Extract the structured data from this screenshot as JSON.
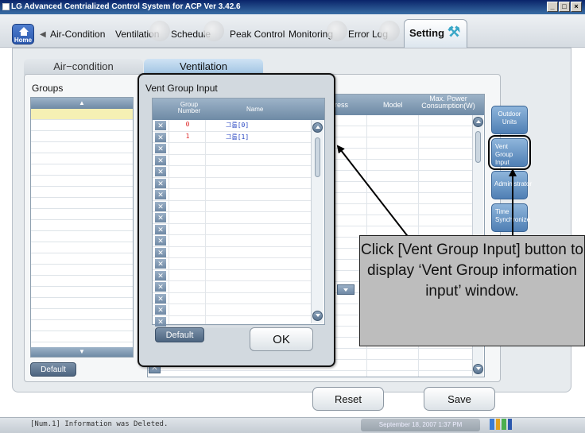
{
  "window": {
    "title": "LG Advanced Centrialized Control System for ACP Ver 3.42.6",
    "buttons": [
      "_",
      "□",
      "×"
    ]
  },
  "nav": {
    "home_label": "Home",
    "tabs": [
      "Air-Condition",
      "Ventilation",
      "Schedule",
      "Peak Control",
      "Monitoring",
      "Error Log",
      "Setting"
    ],
    "active_tab": "Setting"
  },
  "subtabs": {
    "items": [
      "Air−condition",
      "Ventilation"
    ],
    "active": "Ventilation"
  },
  "groups_panel": {
    "label": "Groups",
    "default_button": "Default"
  },
  "unit_table": {
    "headers": [
      "ress",
      "Model",
      "Max. Power\nConsumption(W)"
    ]
  },
  "side_buttons": {
    "outdoor_units": "Outdoor Units",
    "vent_group_input": "Vent Group Input",
    "administrator": "Administrator",
    "time_synchronize": "Time Synchronize"
  },
  "dialog": {
    "title": "Vent Group Input",
    "headers": {
      "group_number": "Group Number",
      "name": "Name"
    },
    "rows": [
      {
        "number": "0",
        "name": "그룹[0]"
      },
      {
        "number": "1",
        "name": "그룹[1]"
      }
    ],
    "empty_row_count": 15,
    "default_button": "Default",
    "ok_button": "OK"
  },
  "bottom_buttons": {
    "reset": "Reset",
    "save": "Save"
  },
  "status": {
    "message": "[Num.1] Information was Deleted.",
    "datetime": "September 18, 2007 1:37 PM"
  },
  "callout": {
    "text": "Click [Vent Group Input] button to display ‘Vent Group information input’ window."
  },
  "colors": {
    "accent": "#4f7fb4",
    "row_selected": "#f5f0b4",
    "group_number_text": "#dd2222",
    "group_name_text": "#2342c0",
    "callout_bg": "#bdbdbd"
  }
}
